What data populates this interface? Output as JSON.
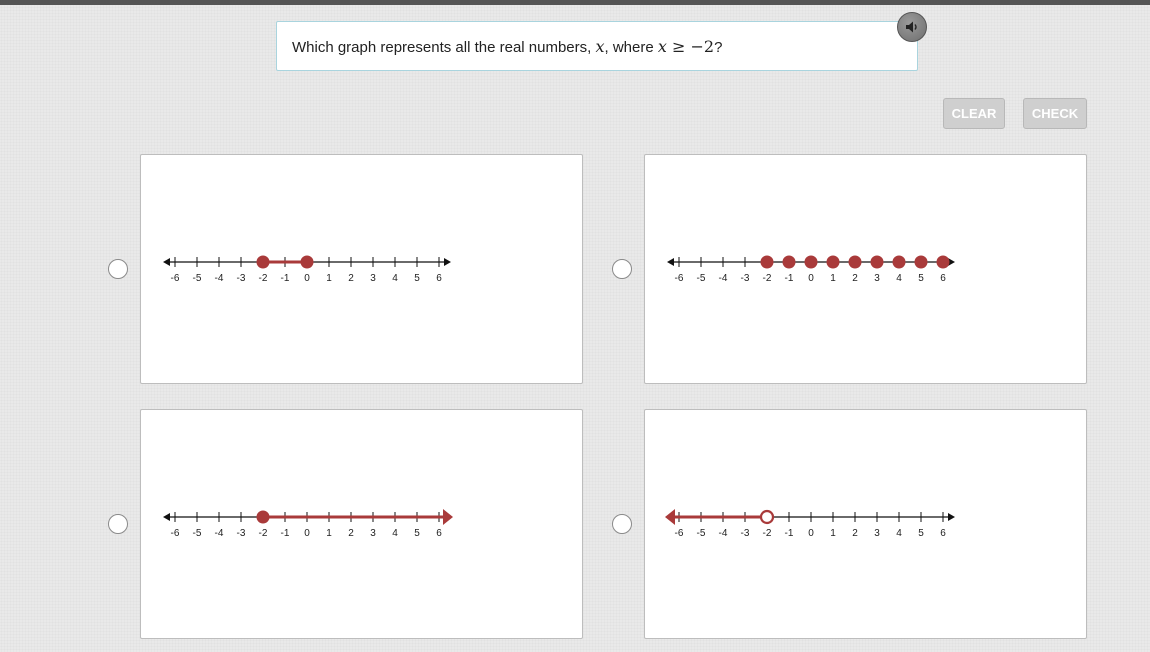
{
  "question": {
    "prefix": "Which graph represents all the real numbers, ",
    "variable": "x",
    "middle": ", where ",
    "inequality_var": "x",
    "inequality_rest": " ≥ −2",
    "suffix": "?"
  },
  "toolbar": {
    "clear_label": "CLEAR",
    "check_label": "CHECK"
  },
  "audio": {
    "icon": "speaker-icon"
  },
  "colors": {
    "graph_accent": "#a93a3a",
    "question_border": "#a9d4de",
    "button_bg": "#cfcfcf"
  },
  "number_line": {
    "min": -6,
    "max": 6,
    "tick_labels": [
      "-6",
      "-5",
      "-4",
      "-3",
      "-2",
      "-1",
      "0",
      "1",
      "2",
      "3",
      "4",
      "5",
      "6"
    ]
  },
  "options": [
    {
      "id": "a",
      "graph": "closed dots at -2 and 0 joined by a segment",
      "points": [
        -2,
        0
      ],
      "point_style": "closed",
      "segment": [
        -2,
        0
      ],
      "ray": null
    },
    {
      "id": "b",
      "graph": "closed dots at each integer from -2 to 6",
      "points": [
        -2,
        -1,
        0,
        1,
        2,
        3,
        4,
        5,
        6
      ],
      "point_style": "closed",
      "segment": null,
      "ray": null
    },
    {
      "id": "c",
      "graph": "closed dot at -2 with a ray to the right",
      "points": [
        -2
      ],
      "point_style": "closed",
      "segment": null,
      "ray": {
        "from": -2,
        "direction": "right"
      }
    },
    {
      "id": "d",
      "graph": "open dot at -2 with a ray to the left",
      "points": [
        -2
      ],
      "point_style": "open",
      "segment": null,
      "ray": {
        "from": -2,
        "direction": "left"
      }
    }
  ]
}
